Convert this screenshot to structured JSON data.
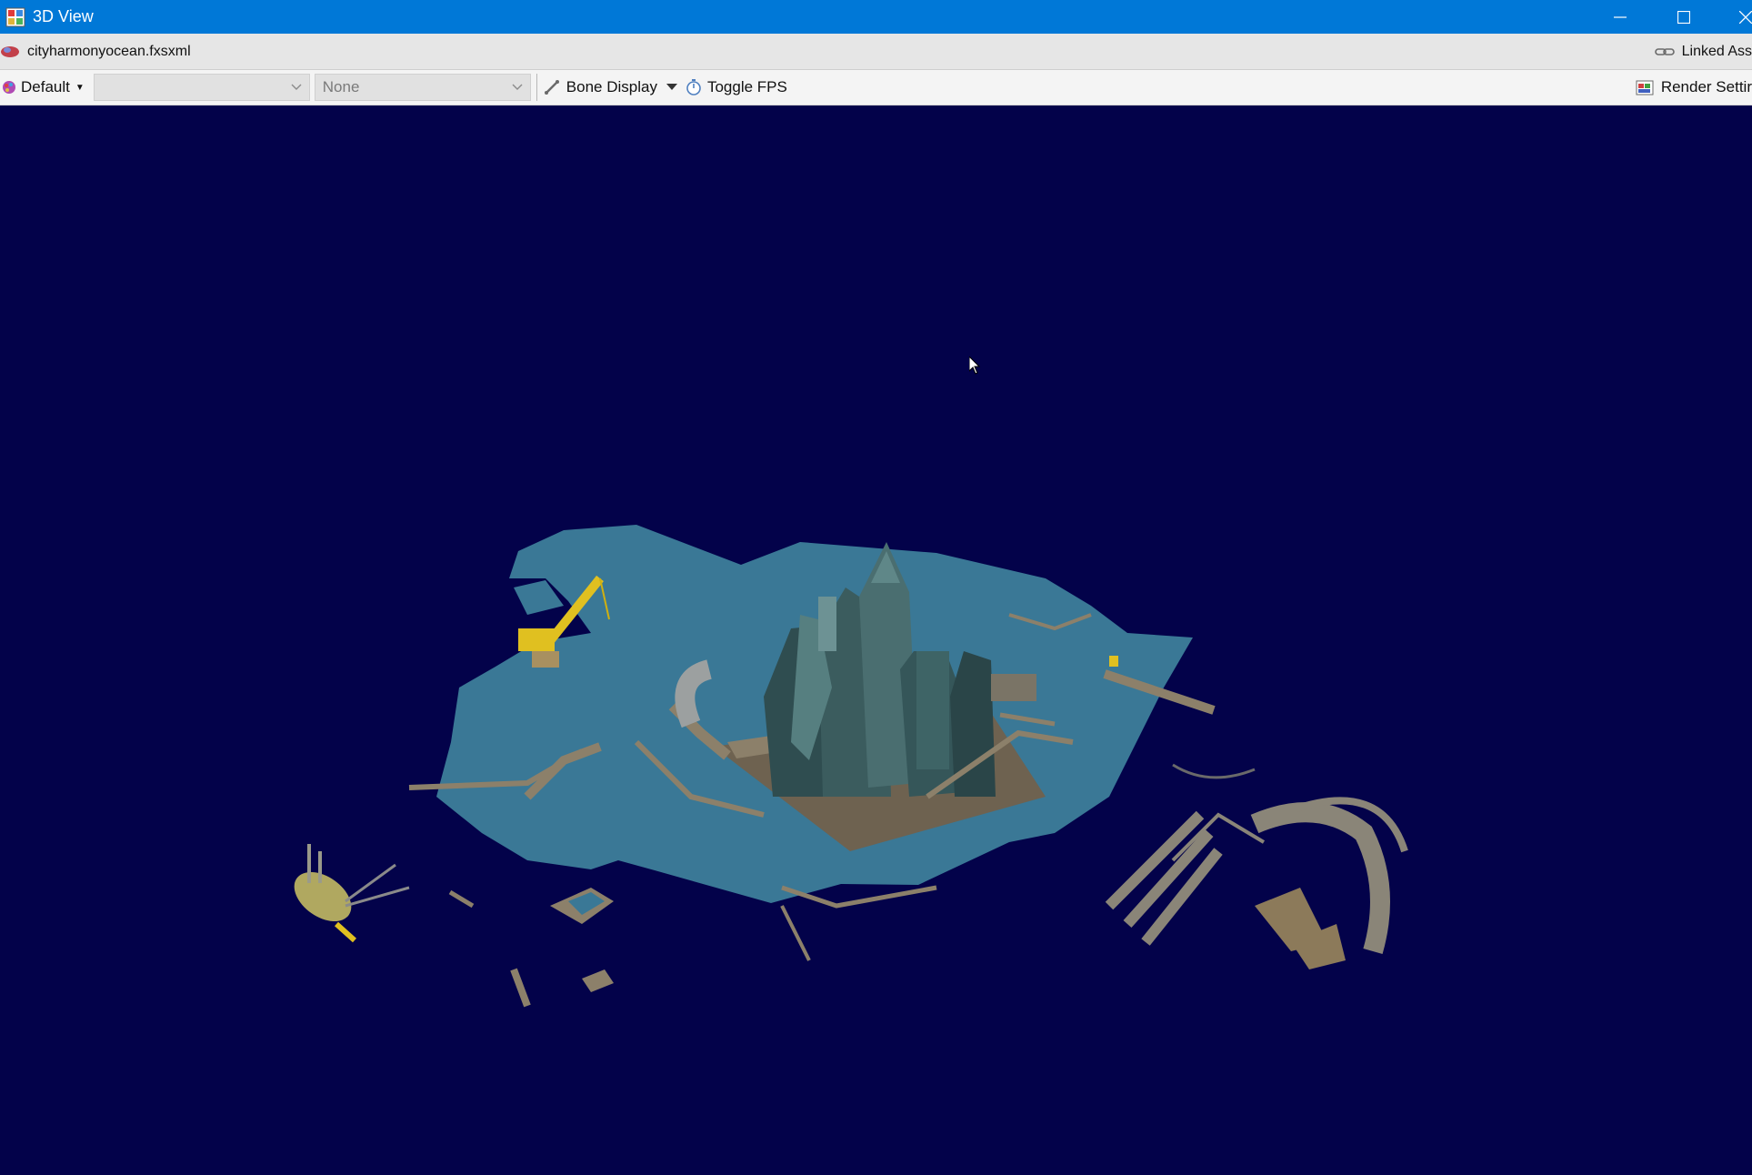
{
  "window": {
    "title": "3D View",
    "icon": "app-window-icon"
  },
  "filebar": {
    "filename": "cityharmonyocean.fxsxml",
    "linked_label": "Linked Ass"
  },
  "toolbar": {
    "default_label": "Default",
    "combo1_value": "",
    "combo2_value": "None",
    "bone_display_label": "Bone Display",
    "toggle_fps_label": "Toggle FPS",
    "render_settings_label": "Render Settir"
  },
  "colors": {
    "titlebar": "#0078d7",
    "viewport_bg": "#03024a",
    "ocean": "#3a7896",
    "building": "#3b5c5e",
    "pipe": "#8c806a",
    "crane": "#e0c020"
  }
}
